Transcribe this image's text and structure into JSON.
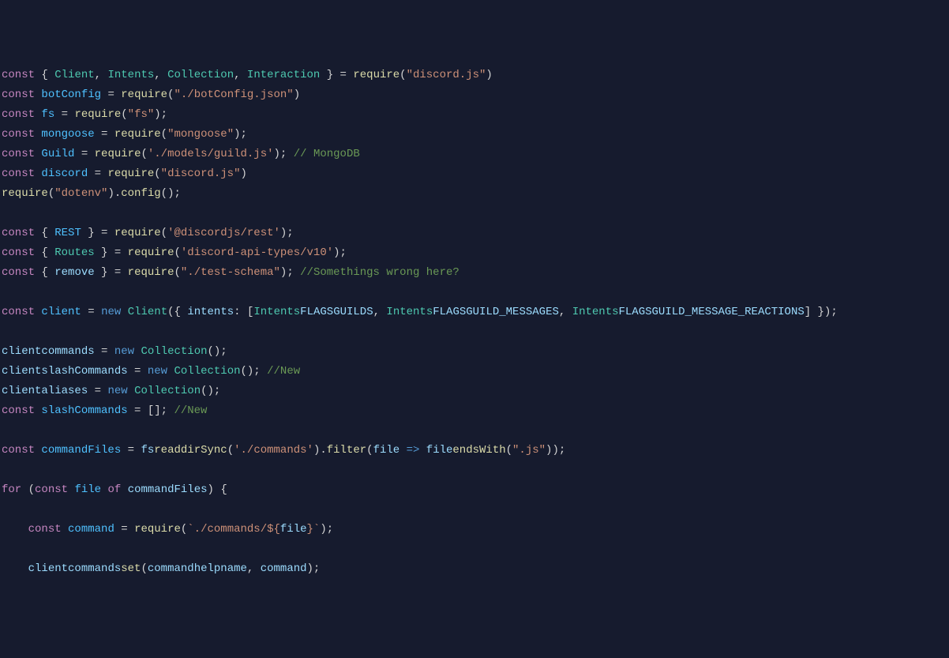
{
  "code": {
    "l1": {
      "kw": "const",
      "pun1": " { ",
      "v1": "Client",
      "c1": ", ",
      "v2": "Intents",
      "c2": ", ",
      "v3": "Collection",
      "c3": ", ",
      "v4": "Interaction",
      "pun2": " } = ",
      "fn": "require",
      "p1": "(",
      "s": "\"discord.js\"",
      "p2": ")"
    },
    "l2": {
      "kw": "const",
      "sp": " ",
      "v": "botConfig",
      "eq": " = ",
      "fn": "require",
      "p1": "(",
      "s": "\"./botConfig.json\"",
      "p2": ")"
    },
    "l3": {
      "kw": "const",
      "sp": " ",
      "v": "fs",
      "eq": " = ",
      "fn": "require",
      "p1": "(",
      "s": "\"fs\"",
      "p2": ");"
    },
    "l4": {
      "kw": "const",
      "sp": " ",
      "v": "mongoose",
      "eq": " = ",
      "fn": "require",
      "p1": "(",
      "s": "\"mongoose\"",
      "p2": ");"
    },
    "l5": {
      "kw": "const",
      "sp": " ",
      "v": "Guild",
      "eq": " = ",
      "fn": "require",
      "p1": "(",
      "s": "'./models/guild.js'",
      "p2": "); ",
      "cmt": "// MongoDB"
    },
    "l6": {
      "kw": "const",
      "sp": " ",
      "v": "discord",
      "eq": " = ",
      "fn": "require",
      "p1": "(",
      "s": "\"discord.js\"",
      "p2": ")"
    },
    "l7": {
      "fn": "require",
      "p1": "(",
      "s": "\"dotenv\"",
      "p2": ").",
      "fn2": "config",
      "p3": "();"
    },
    "l8": {
      "kw": "const",
      "pun1": " { ",
      "v": "REST",
      "pun2": " } = ",
      "fn": "require",
      "p1": "(",
      "s": "'@discordjs/rest'",
      "p2": ");"
    },
    "l9": {
      "kw": "const",
      "pun1": " { ",
      "v": "Routes",
      "pun2": " } = ",
      "fn": "require",
      "p1": "(",
      "s": "'discord-api-types/v10'",
      "p2": ");"
    },
    "l10": {
      "kw": "const",
      "pun1": " { ",
      "v": "remove",
      "pun2": " } = ",
      "fn": "require",
      "p1": "(",
      "s": "\"./test-schema\"",
      "p2": "); ",
      "cmt": "//Somethings wrong here?"
    },
    "l11": {
      "kw": "const",
      "sp": " ",
      "v": "client",
      "eq": " = ",
      "new": "new",
      "sp2": " ",
      "cls": "Client",
      "p1": "({ ",
      "prop": "intents",
      ":": ": [",
      "c1": "Intents",
      ".": ".",
      "c2": "FLAGS",
      ".2": ".",
      "c3": "GUILDS",
      ", ": ", ",
      "c4": "Intents",
      ".3": ".",
      "c5": "FLAGS",
      ".4": ".",
      "c6": "GUILD_MESSAGES",
      ", 2": ", ",
      "c7": "Intents",
      ".5": ".",
      "c8": "FLAGS",
      ".6": ".",
      "c9": "GUILD_MESSAGE_REACTIONS",
      "p2": "] });"
    },
    "l12": {
      "v": "client",
      ".": ".",
      "p": "commands",
      "eq": " = ",
      "new": "new",
      "sp": " ",
      "cls": "Collection",
      "end": "();"
    },
    "l13": {
      "v": "client",
      ".": ".",
      "p": "slashCommands",
      "eq": " = ",
      "new": "new",
      "sp": " ",
      "cls": "Collection",
      "end": "(); ",
      "cmt": "//New"
    },
    "l14": {
      "v": "client",
      ".": ".",
      "p": "aliases",
      "eq": " = ",
      "new": "new",
      "sp": " ",
      "cls": "Collection",
      "end": "();"
    },
    "l15": {
      "kw": "const",
      "sp": " ",
      "v": "slashCommands",
      "eq": " = []; ",
      "cmt": "//New"
    },
    "l16": {
      "kw": "const",
      "sp": " ",
      "v": "commandFiles",
      "eq": " = ",
      "v2": "fs",
      ".": ".",
      "fn": "readdirSync",
      "p1": "(",
      "s": "'./commands'",
      "p2": ").",
      "fn2": "filter",
      "p3": "(",
      "v3": "file",
      "ar": " => ",
      "v4": "file",
      ".2": ".",
      "fn3": "endsWith",
      "p4": "(",
      "s2": "\".js\"",
      "p5": "));"
    },
    "l17": {
      "kw": "for",
      "p1": " (",
      "kw2": "const",
      "sp": " ",
      "v": "file",
      "sp2": " ",
      "kw3": "of",
      "sp3": " ",
      "v2": "commandFiles",
      "p2": ") {"
    },
    "l18": {
      "ind": "    ",
      "kw": "const",
      "sp": " ",
      "v": "command",
      "eq": " = ",
      "fn": "require",
      "p1": "(",
      "s": "`./commands/${",
      "v2": "file",
      "s2": "}`",
      "p2": ");"
    },
    "l19": {
      "ind": "    ",
      "v": "client",
      ".": ".",
      "p": "commands",
      ".2": ".",
      "fn": "set",
      "p1": "(",
      "v2": "command",
      ".3": ".",
      "p2": "help",
      ".4": ".",
      "p3": "name",
      ", ": ", ",
      "v3": "command",
      "end": ");"
    }
  }
}
